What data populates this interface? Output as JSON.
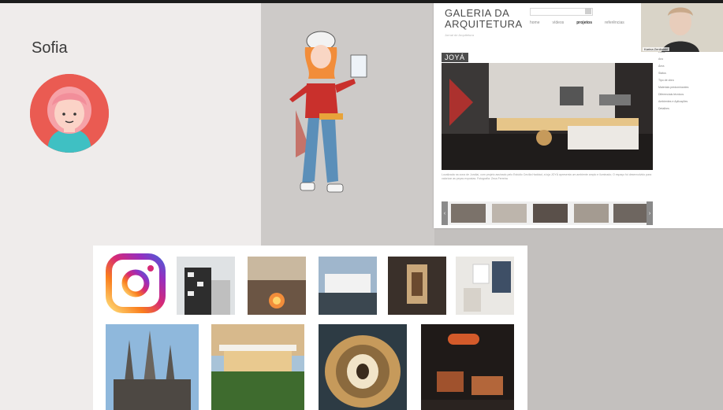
{
  "presenter": {
    "name": "Sofia"
  },
  "website": {
    "title": "GALERIA DA ARQUITETURA",
    "subtitle": "Jornal de Arquitetura",
    "nav": [
      "home",
      "vídeos",
      "projetos",
      "referências"
    ],
    "active_nav": "projetos",
    "badge": "JOYÁ",
    "caption": "Localizada na zona de Jundiaí, com projeto assinado pelo Estúdio Cecília Haddad, a loja JOYÁ apresenta um ambiente amplo e iluminado; O espaço foi desenvolvido para valorizar as peças expostas. Fotografia: Zeca Ferreira",
    "side_info": [
      "Local",
      "Ano",
      "Área",
      "Status",
      "Tipo de obra",
      "Materiais predominantes",
      "Diferenciais técnicos",
      "Ambientes e Aplicações",
      "Detalhes"
    ],
    "arrow_left": "‹",
    "arrow_right": "›"
  },
  "webcam": {
    "name": "Karina Zeniboski"
  },
  "instagram": {
    "logo": "instagram-logo"
  },
  "colors": {
    "avatar_bg": "#ea5b52",
    "avatar_shirt": "#3fc0c3",
    "avatar_hair": "#f6a2a8",
    "ig_gradient": [
      "#feda75",
      "#fa7e1e",
      "#d62976",
      "#962fbf",
      "#4f5bd5"
    ]
  }
}
